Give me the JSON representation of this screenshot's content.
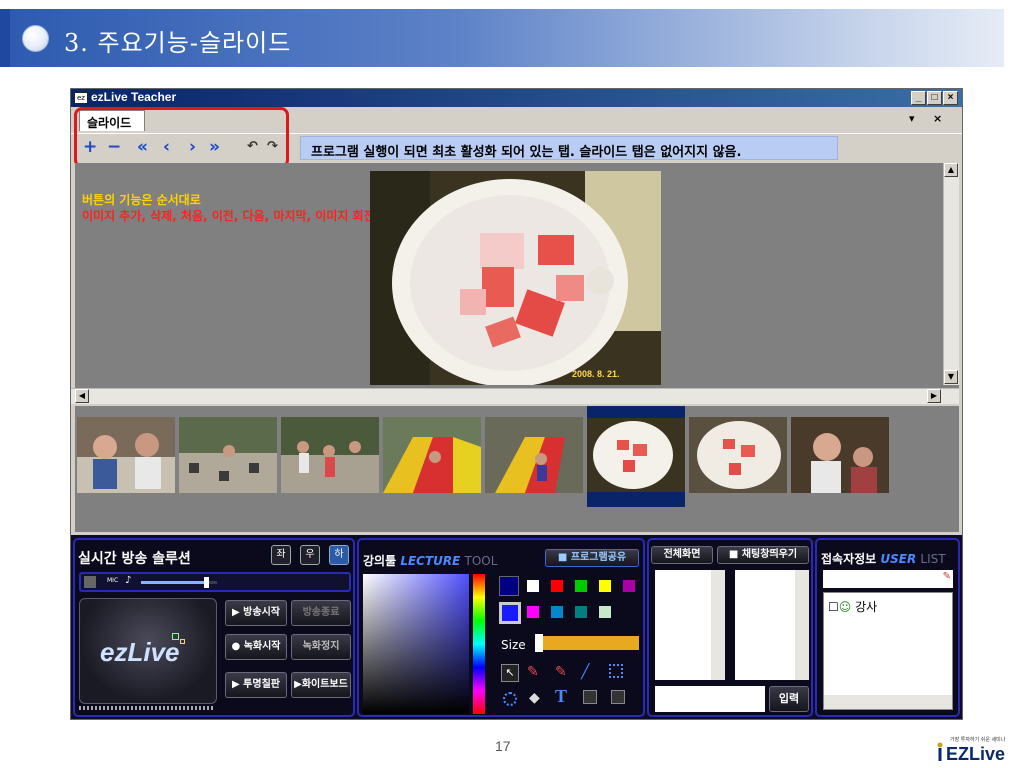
{
  "slide": {
    "title": "3. 주요기능-슬라이드",
    "page_number": "17",
    "brand": "EZLive",
    "brand_tagline": "가장 투자하기 쉬운 세미나"
  },
  "window": {
    "title": "ezLive Teacher",
    "icon_label": "ez",
    "controls": {
      "minimize": "_",
      "maximize": "□",
      "close": "×"
    },
    "tab_label": "슬라이드",
    "tab_dropdown": "▾",
    "tab_close": "×"
  },
  "toolbar": {
    "add": "+",
    "delete": "−",
    "first": "«",
    "prev": "‹",
    "next": "›",
    "last": "»",
    "rotate_left": "↶",
    "rotate_right": "↷",
    "note": "프로그램 실행이 되면 최초 활성화 되어 있는 탭. 슬라이드 탭은 없어지지 않음."
  },
  "viewer": {
    "caption_line1": "버튼의 기능은 순서대로",
    "caption_line2": "이미지 추가, 삭제, 처음, 이전, 다음, 마지막, 이미지 회전.",
    "photo_stamp": "2008. 8. 21."
  },
  "thumbnails": {
    "count": 8,
    "selected_index": 5
  },
  "broadcast_panel": {
    "title": "실시간 방송 솔루션",
    "pos_left": "좌",
    "pos_right": "우",
    "pos_bottom": "하",
    "mic_label": "MIC",
    "mic_level": 0.85,
    "logo": "ezLive",
    "start_broadcast": "▶ 방송시작",
    "stop_broadcast": "방송종료",
    "start_record": "● 녹화시작",
    "stop_record": "녹화정지",
    "transparent_board": "▶ 투명칠판",
    "whiteboard": "▶화이트보드"
  },
  "lecture_panel": {
    "title_kr": "강의툴",
    "title_en_1": "LECTURE",
    "title_en_2": "TOOL",
    "share_program": "프로그램공유",
    "size_label": "Size",
    "text_tool": "T",
    "swatches_row1": [
      "#ffffff",
      "#ff0000",
      "#00cc00",
      "#ffff00",
      "#aa00aa"
    ],
    "swatches_row2": [
      "#ff00ff",
      "#0088cc",
      "#008080",
      "#c8e8c8"
    ],
    "current_color": "#1a1aff"
  },
  "chat_panel": {
    "full_screen": "전체화면",
    "chat_popup": "채팅창띄우기",
    "send": "입력"
  },
  "user_panel": {
    "title_kr": "접속자정보",
    "title_en_1": "USER",
    "title_en_2": "LIST",
    "users": [
      "강사"
    ]
  }
}
